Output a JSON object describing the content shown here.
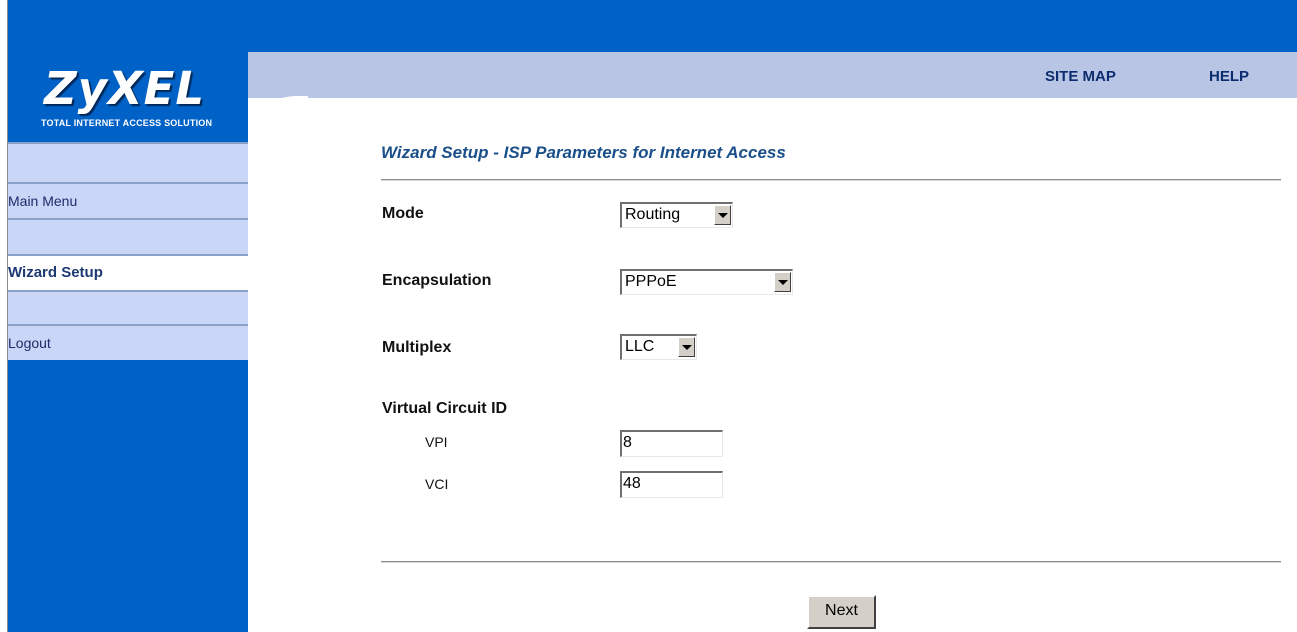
{
  "brand": {
    "logo": "ZyXEL",
    "tagline": "Total Internet Access Solution"
  },
  "top_links": {
    "site_map": "SITE MAP",
    "help": "HELP"
  },
  "nav": {
    "main_menu": "Main Menu",
    "wizard_setup": "Wizard Setup",
    "logout": "Logout"
  },
  "page": {
    "title": "Wizard Setup - ISP Parameters for Internet Access"
  },
  "form": {
    "mode": {
      "label": "Mode",
      "value": "Routing"
    },
    "encapsulation": {
      "label": "Encapsulation",
      "value": "PPPoE"
    },
    "multiplex": {
      "label": "Multiplex",
      "value": "LLC"
    },
    "virtual_circuit": {
      "label": "Virtual Circuit ID",
      "vpi_label": "VPI",
      "vpi_value": "8",
      "vci_label": "VCI",
      "vci_value": "48"
    }
  },
  "actions": {
    "next": "Next"
  },
  "colors": {
    "brand_blue": "#0062C6",
    "nav_light": "#C9D6F7",
    "title_blue": "#1B4F8A"
  }
}
